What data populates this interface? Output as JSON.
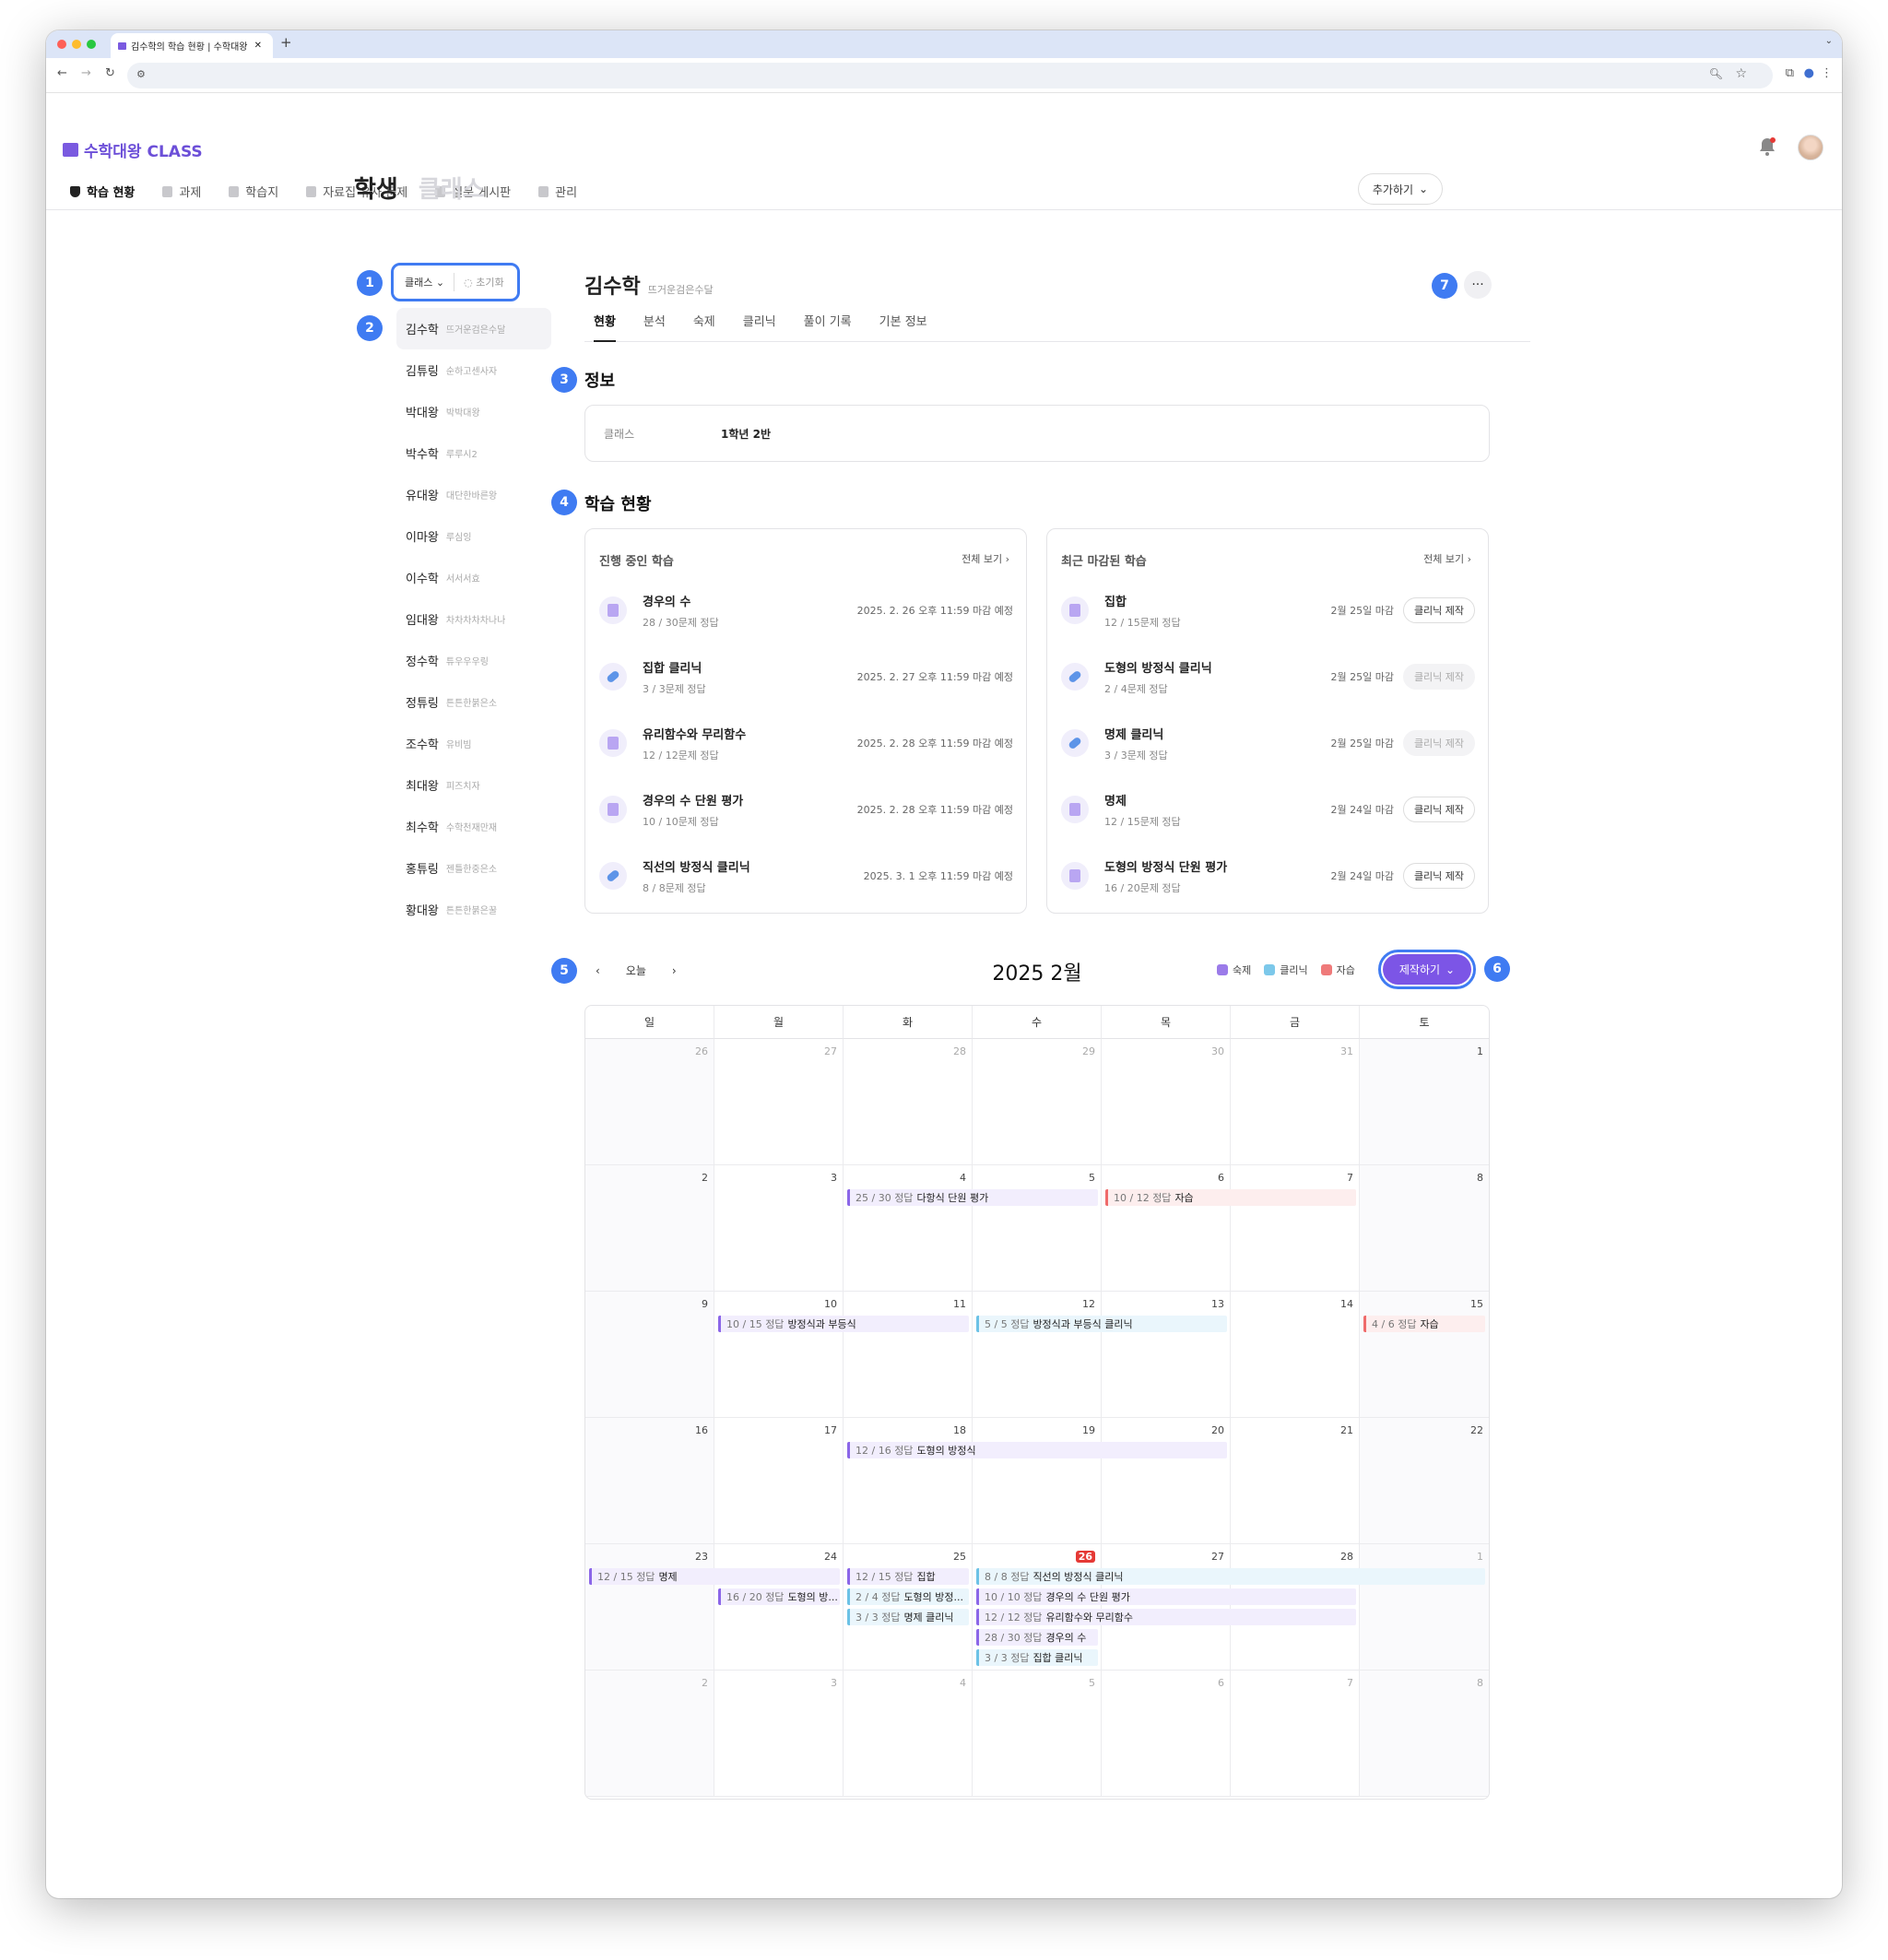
{
  "browser": {
    "tab_title": "김수학의 학습 현황 | 수학대왕 CLASS",
    "new_tab": "+"
  },
  "app": {
    "logo_text": "수학대왕 CLASS",
    "brand_color": "#6c4fd8"
  },
  "nav": {
    "items": [
      "학습 현황",
      "과제",
      "학습지",
      "자료집 유사 문제",
      "질문 게시판",
      "관리"
    ],
    "active": 0
  },
  "page": {
    "tab_students": "학생",
    "tab_classes": "클래스",
    "add_button": "추가하기"
  },
  "badges": [
    "1",
    "2",
    "3",
    "4",
    "5",
    "6",
    "7"
  ],
  "filter": {
    "class_label": "클래스",
    "reset_label": "초기화"
  },
  "students": [
    {
      "name": "김수학",
      "nick": "뜨거운검은수달"
    },
    {
      "name": "김튜링",
      "nick": "순하고센사자"
    },
    {
      "name": "박대왕",
      "nick": "박박대왕"
    },
    {
      "name": "박수학",
      "nick": "루루시2"
    },
    {
      "name": "유대왕",
      "nick": "대단한바른왕"
    },
    {
      "name": "이마왕",
      "nick": "루심잉"
    },
    {
      "name": "이수학",
      "nick": "서서서효"
    },
    {
      "name": "임대왕",
      "nick": "차차차차차나나"
    },
    {
      "name": "정수학",
      "nick": "튜우우우링"
    },
    {
      "name": "정튜링",
      "nick": "튼튼한붉은소"
    },
    {
      "name": "조수학",
      "nick": "유비빔"
    },
    {
      "name": "최대왕",
      "nick": "피즈치자"
    },
    {
      "name": "최수학",
      "nick": "수학천재만재"
    },
    {
      "name": "홍튜링",
      "nick": "젠틀한중은소"
    },
    {
      "name": "황대왕",
      "nick": "튼튼한붉은꿀"
    }
  ],
  "selected": {
    "name": "김수학",
    "nick": "뜨거운검은수달",
    "more": "···"
  },
  "student_tabs": [
    "현황",
    "분석",
    "숙제",
    "클리닉",
    "풀이 기록",
    "기본 정보"
  ],
  "info": {
    "title": "정보",
    "class_key": "클래스",
    "class_value": "1학년 2반"
  },
  "study": {
    "title": "학습 현황"
  },
  "ongoing": {
    "title": "진행 중인 학습",
    "view_all": "전체 보기",
    "items": [
      {
        "name": "경우의 수",
        "score": "28 / 30문제 정답",
        "due": "2025. 2. 26 오후 11:59 마감 예정",
        "icon": "doc"
      },
      {
        "name": "집합 클리닉",
        "score": "3 / 3문제 정답",
        "due": "2025. 2. 27 오후 11:59 마감 예정",
        "icon": "pill"
      },
      {
        "name": "유리함수와 무리함수",
        "score": "12 / 12문제 정답",
        "due": "2025. 2. 28 오후 11:59 마감 예정",
        "icon": "doc"
      },
      {
        "name": "경우의 수 단원 평가",
        "score": "10 / 10문제 정답",
        "due": "2025. 2. 28 오후 11:59 마감 예정",
        "icon": "doc"
      },
      {
        "name": "직선의 방정식 클리닉",
        "score": "8 / 8문제 정답",
        "due": "2025. 3. 1 오후 11:59 마감 예정",
        "icon": "pill"
      }
    ]
  },
  "closed": {
    "title": "최근 마감된 학습",
    "view_all": "전체 보기",
    "clinic_label": "클리닉 제작",
    "items": [
      {
        "name": "집합",
        "score": "12 / 15문제 정답",
        "due": "2월 25일 마감",
        "icon": "doc",
        "enabled": true
      },
      {
        "name": "도형의 방정식 클리닉",
        "score": "2 / 4문제 정답",
        "due": "2월 25일 마감",
        "icon": "pill",
        "enabled": false
      },
      {
        "name": "명제 클리닉",
        "score": "3 / 3문제 정답",
        "due": "2월 25일 마감",
        "icon": "pill",
        "enabled": false
      },
      {
        "name": "명제",
        "score": "12 / 15문제 정답",
        "due": "2월 24일 마감",
        "icon": "doc",
        "enabled": true
      },
      {
        "name": "도형의 방정식 단원 평가",
        "score": "16 / 20문제 정답",
        "due": "2월 24일 마감",
        "icon": "doc",
        "enabled": true
      }
    ]
  },
  "calendar": {
    "title": "2025 2월",
    "today_label": "오늘",
    "make_label": "제작하기",
    "legend": [
      {
        "label": "숙제",
        "color": "#9b7be9"
      },
      {
        "label": "클리닉",
        "color": "#7cc8ea"
      },
      {
        "label": "자습",
        "color": "#ef7a7a"
      }
    ],
    "weekdays": [
      "일",
      "월",
      "화",
      "수",
      "목",
      "금",
      "토"
    ],
    "weeks": [
      [
        26,
        27,
        28,
        29,
        30,
        31,
        1
      ],
      [
        2,
        3,
        4,
        5,
        6,
        7,
        8
      ],
      [
        9,
        10,
        11,
        12,
        13,
        14,
        15
      ],
      [
        16,
        17,
        18,
        19,
        20,
        21,
        22
      ],
      [
        23,
        24,
        25,
        26,
        27,
        28,
        1
      ],
      [
        2,
        3,
        4,
        5,
        6,
        7,
        8
      ]
    ],
    "today": {
      "week": 4,
      "day": 3
    },
    "events": [
      {
        "week": 1,
        "start": 2,
        "span": 2,
        "lane": 0,
        "kind": "h",
        "score": "25 / 30 정답",
        "title": "다항식 단원 평가"
      },
      {
        "week": 1,
        "start": 4,
        "span": 2,
        "lane": 0,
        "kind": "s",
        "score": "10 / 12 정답",
        "title": "자습"
      },
      {
        "week": 2,
        "start": 1,
        "span": 2,
        "lane": 0,
        "kind": "h",
        "score": "10 / 15 정답",
        "title": "방정식과 부등식"
      },
      {
        "week": 2,
        "start": 3,
        "span": 2,
        "lane": 0,
        "kind": "c",
        "score": "5 / 5 정답",
        "title": "방정식과 부등식 클리닉"
      },
      {
        "week": 2,
        "start": 6,
        "span": 1,
        "lane": 0,
        "kind": "s",
        "score": "4 / 6 정답",
        "title": "자습"
      },
      {
        "week": 3,
        "start": 2,
        "span": 3,
        "lane": 0,
        "kind": "h",
        "score": "12 / 16 정답",
        "title": "도형의 방정식"
      },
      {
        "week": 4,
        "start": 0,
        "span": 2,
        "lane": 0,
        "kind": "h",
        "score": "12 / 15 정답",
        "title": "명제"
      },
      {
        "week": 4,
        "start": 1,
        "span": 1,
        "lane": 1,
        "kind": "h",
        "score": "16 / 20 정답",
        "title": "도형의 방..."
      },
      {
        "week": 4,
        "start": 2,
        "span": 1,
        "lane": 0,
        "kind": "h",
        "score": "12 / 15 정답",
        "title": "집합"
      },
      {
        "week": 4,
        "start": 2,
        "span": 1,
        "lane": 1,
        "kind": "c",
        "score": "2 / 4 정답",
        "title": "도형의 방정..."
      },
      {
        "week": 4,
        "start": 2,
        "span": 1,
        "lane": 2,
        "kind": "c",
        "score": "3 / 3 정답",
        "title": "명제 클리닉"
      },
      {
        "week": 4,
        "start": 3,
        "span": 4,
        "lane": 0,
        "kind": "c",
        "score": "8 / 8 정답",
        "title": "직선의 방정식 클리닉"
      },
      {
        "week": 4,
        "start": 3,
        "span": 3,
        "lane": 1,
        "kind": "h",
        "score": "10 / 10 정답",
        "title": "경우의 수 단원 평가"
      },
      {
        "week": 4,
        "start": 3,
        "span": 3,
        "lane": 2,
        "kind": "h",
        "score": "12 / 12 정답",
        "title": "유리함수와 무리함수"
      },
      {
        "week": 4,
        "start": 3,
        "span": 1,
        "lane": 3,
        "kind": "h",
        "score": "28 / 30 정답",
        "title": "경우의 수"
      },
      {
        "week": 4,
        "start": 3,
        "span": 1,
        "lane": 4,
        "kind": "c",
        "score": "3 / 3 정답",
        "title": "집합 클리닉"
      }
    ]
  }
}
